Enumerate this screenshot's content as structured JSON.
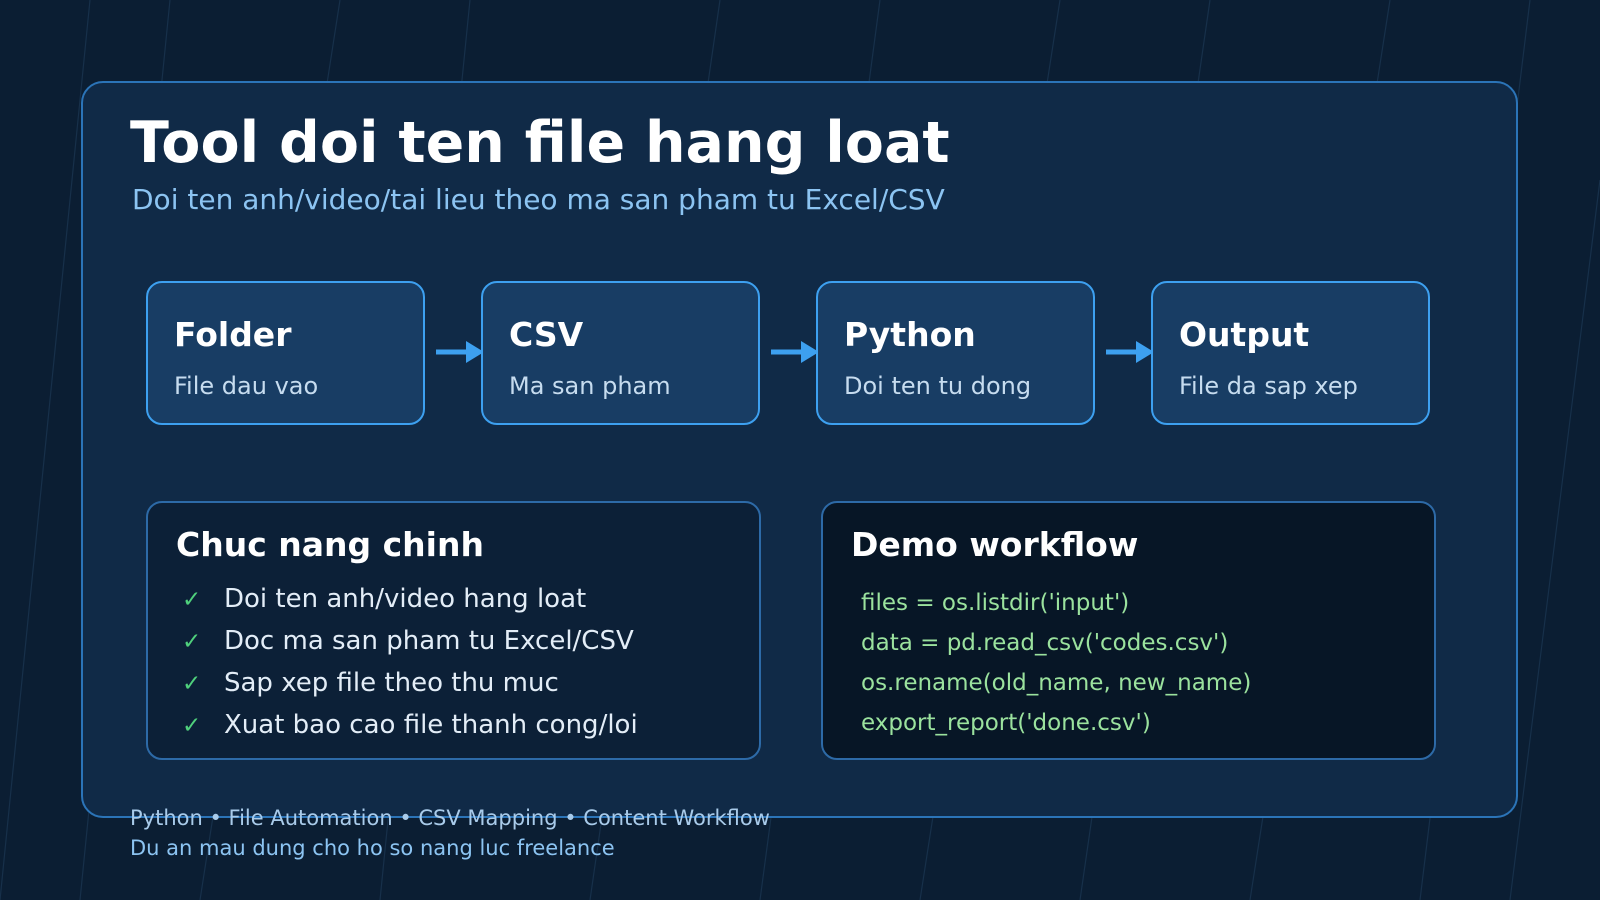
{
  "header": {
    "title": "Tool doi ten file hang loat",
    "subtitle": "Doi ten anh/video/tai lieu theo ma san pham tu Excel/CSV"
  },
  "flow": {
    "steps": [
      {
        "title": "Folder",
        "desc": "File dau vao"
      },
      {
        "title": "CSV",
        "desc": "Ma san pham"
      },
      {
        "title": "Python",
        "desc": "Doi ten tu dong"
      },
      {
        "title": "Output",
        "desc": "File da sap xep"
      }
    ]
  },
  "features": {
    "title": "Chuc nang chinh",
    "check_symbol": "✓",
    "items": [
      "Doi ten anh/video hang loat",
      "Doc ma san pham tu Excel/CSV",
      "Sap xep file theo thu muc",
      "Xuat bao cao file thanh cong/loi"
    ]
  },
  "demo": {
    "title": "Demo workflow",
    "code": [
      "files = os.listdir('input')",
      "data = pd.read_csv('codes.csv')",
      "os.rename(old_name, new_name)",
      "export_report('done.csv')"
    ]
  },
  "footer": {
    "tags": "Python • File Automation • CSV Mapping • Content Workflow",
    "note": "Du an mau dung cho ho so nang luc freelance"
  },
  "colors": {
    "background": "#0b1e33",
    "card": "#102a47",
    "accent": "#3da0f0",
    "check": "#4fd07c",
    "code": "#9be29e"
  }
}
